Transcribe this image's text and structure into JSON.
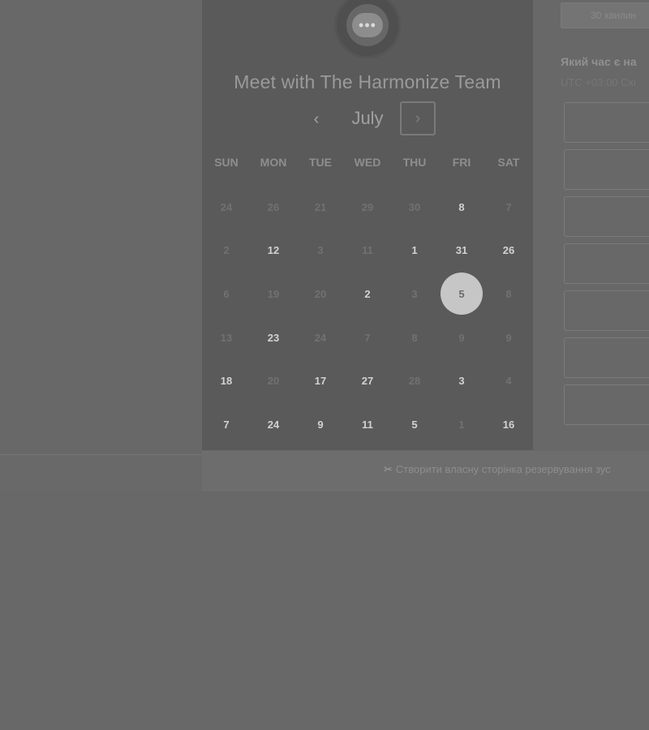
{
  "calendar": {
    "title": "Meet with The Harmonize Team",
    "month": "July",
    "prev_icon": "chevron-left-icon",
    "next_icon": "chevron-right-icon",
    "logo_icon": "chat-bubble-icon",
    "weekdays": [
      "SUN",
      "MON",
      "TUE",
      "WED",
      "THU",
      "FRI",
      "SAT"
    ],
    "rows": [
      [
        {
          "label": "24",
          "state": "muted"
        },
        {
          "label": "26",
          "state": "muted"
        },
        {
          "label": "21",
          "state": "muted"
        },
        {
          "label": "29",
          "state": "muted"
        },
        {
          "label": "30",
          "state": "muted"
        },
        {
          "label": "8",
          "state": "available"
        },
        {
          "label": "7",
          "state": "muted"
        }
      ],
      [
        {
          "label": "2",
          "state": "muted"
        },
        {
          "label": "12",
          "state": "available"
        },
        {
          "label": "3",
          "state": "muted"
        },
        {
          "label": "11",
          "state": "muted"
        },
        {
          "label": "1",
          "state": "available"
        },
        {
          "label": "31",
          "state": "available"
        },
        {
          "label": "26",
          "state": "available"
        }
      ],
      [
        {
          "label": "6",
          "state": "muted"
        },
        {
          "label": "19",
          "state": "muted"
        },
        {
          "label": "20",
          "state": "muted"
        },
        {
          "label": "2",
          "state": "available"
        },
        {
          "label": "3",
          "state": "muted"
        },
        {
          "label": "5",
          "state": "selected"
        },
        {
          "label": "8",
          "state": "muted"
        }
      ],
      [
        {
          "label": "13",
          "state": "muted"
        },
        {
          "label": "23",
          "state": "available"
        },
        {
          "label": "24",
          "state": "muted"
        },
        {
          "label": "7",
          "state": "muted"
        },
        {
          "label": "8",
          "state": "muted"
        },
        {
          "label": "9",
          "state": "muted"
        },
        {
          "label": "9",
          "state": "muted"
        }
      ],
      [
        {
          "label": "18",
          "state": "available"
        },
        {
          "label": "20",
          "state": "muted"
        },
        {
          "label": "17",
          "state": "available"
        },
        {
          "label": "27",
          "state": "available"
        },
        {
          "label": "28",
          "state": "muted"
        },
        {
          "label": "3",
          "state": "available"
        },
        {
          "label": "4",
          "state": "muted"
        }
      ],
      [
        {
          "label": "7",
          "state": "available"
        },
        {
          "label": "24",
          "state": "available"
        },
        {
          "label": "9",
          "state": "available"
        },
        {
          "label": "11",
          "state": "available"
        },
        {
          "label": "5",
          "state": "available"
        },
        {
          "label": "1",
          "state": "muted"
        },
        {
          "label": "16",
          "state": "available"
        }
      ]
    ]
  },
  "time_panel": {
    "duration": "30 хвилин",
    "question": "Який час є на",
    "timezone": "UTC +03:00 Схі",
    "slot_count": 7
  },
  "footer": {
    "icon": "scissors-icon",
    "link": "Створити власну сторінка резервування зус"
  },
  "colors": {
    "overlay": "#686868",
    "panel": "#5a5a5a",
    "selected_day": "#c6c6c6"
  }
}
